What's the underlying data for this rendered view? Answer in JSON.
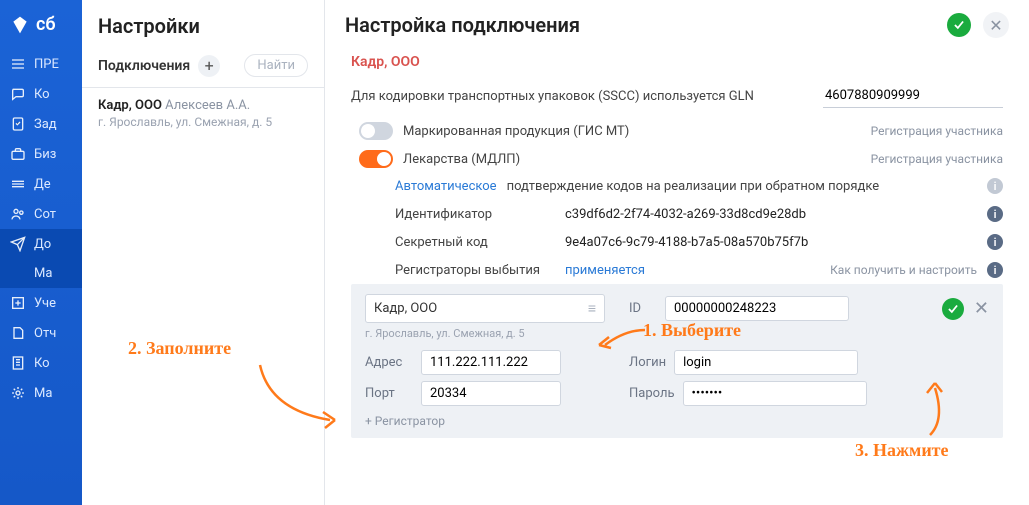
{
  "nav": {
    "brand": "сб",
    "items": [
      {
        "label": "ПРЕ"
      },
      {
        "label": "Ко"
      },
      {
        "label": "Зад"
      },
      {
        "label": "Биз"
      },
      {
        "label": "Де"
      },
      {
        "label": "Сот"
      },
      {
        "label": "До"
      },
      {
        "label": "Ма"
      },
      {
        "label": "Уче"
      },
      {
        "label": "Отч"
      },
      {
        "label": "Ко"
      },
      {
        "label": "Ма"
      }
    ]
  },
  "settings": {
    "title": "Настройки",
    "subtitle": "Подключения",
    "search_placeholder": "Найти",
    "connection": {
      "org": "Кадр, ООО",
      "person": "Алексеев А.А.",
      "address": "г. Ярославль, ул. Смежная, д. 5"
    }
  },
  "panel": {
    "title": "Настройка подключения",
    "org": "Кадр, ООО",
    "gln_label": "Для кодировки транспортных упаковок (SSCC) используется GLN",
    "gln_value": "4607880909999",
    "toggles": {
      "marking": {
        "label": "Маркированная продукция (ГИС МТ)",
        "side": "Регистрация участника"
      },
      "meds": {
        "label": "Лекарства (МДЛП)",
        "side": "Регистрация участника"
      }
    },
    "auto": {
      "link": "Автоматическое",
      "rest": "подтверждение кодов на реализации при обратном порядке"
    },
    "ident": {
      "k": "Идентификатор",
      "v": "c39df6d2-2f74-4032-a269-33d8cd9e28db"
    },
    "secret": {
      "k": "Секретный код",
      "v": "9e4a07c6-9c79-4188-b7a5-08a570b75f7b"
    },
    "reg": {
      "k": "Регистраторы выбытия",
      "link": "применяется",
      "side": "Как получить и настроить"
    },
    "reg_panel": {
      "org": "Кадр, ООО",
      "addr": "г. Ярославль, ул. Смежная, д. 5",
      "id_label": "ID",
      "id": "00000000248223",
      "addr_label": "Адрес",
      "addr_val": "111.222.111.222",
      "login_label": "Логин",
      "login": "login",
      "port_label": "Порт",
      "port": "20334",
      "pass_label": "Пароль",
      "pass": "•••••••",
      "add": "+ Регистратор"
    }
  },
  "annotations": {
    "a1": "1. Выберите",
    "a2": "2. Заполните",
    "a3": "3. Нажмите"
  }
}
